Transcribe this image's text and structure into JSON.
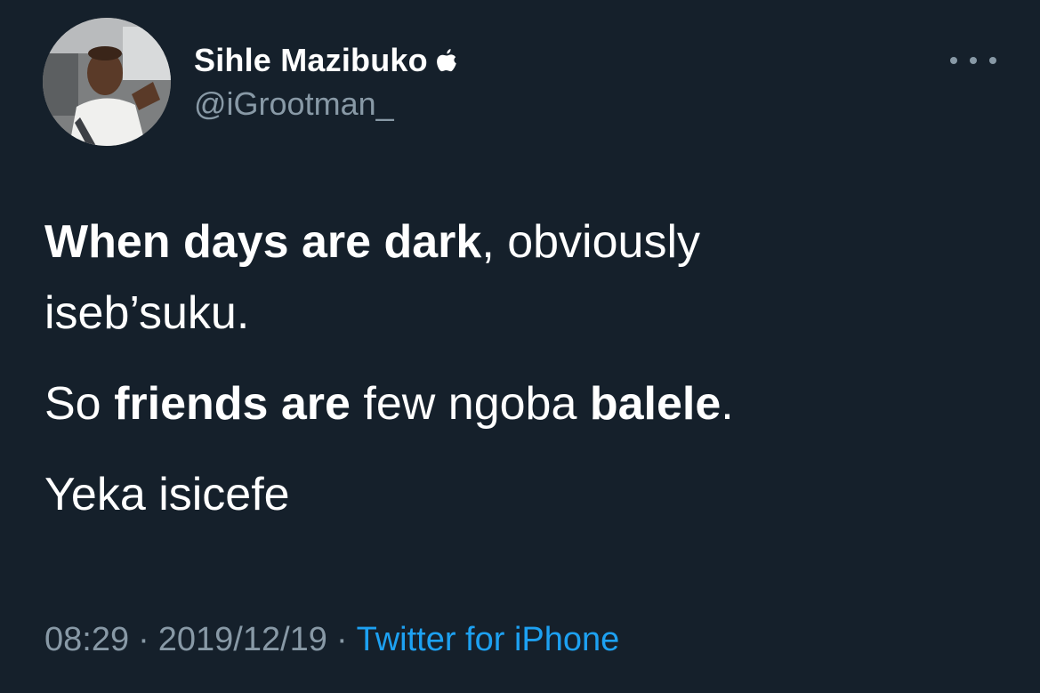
{
  "tweet": {
    "author": {
      "display_name": "Sihle Mazibuko",
      "badge_icon": "apple-icon",
      "handle": "@iGrootman_"
    },
    "more_icon": "more-options-icon",
    "body": {
      "line1_bold": "When days are dark",
      "line1_rest": ", obviously",
      "line2": "iseb’suku.",
      "p2_start": "So ",
      "p2_bold1": "friends are",
      "p2_mid": " few ngoba ",
      "p2_bold2": "balele",
      "p2_end": ".",
      "p3": "Yeka isicefe"
    },
    "meta": {
      "time": "08:29",
      "separator": "·",
      "date": "2019/12/19",
      "source": "Twitter for iPhone"
    }
  },
  "colors": {
    "background": "#15202b",
    "text": "#ffffff",
    "secondary": "#8899a6",
    "link": "#1da1f2"
  }
}
